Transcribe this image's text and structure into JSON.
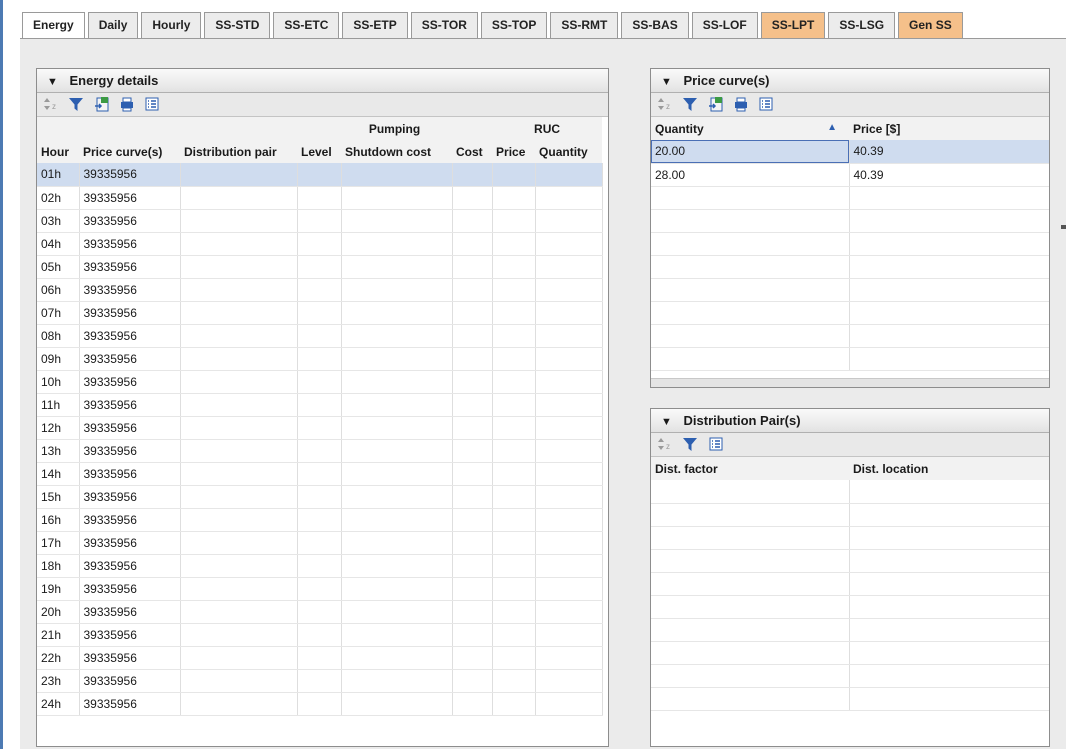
{
  "tabs": [
    {
      "label": "Energy",
      "active": true,
      "orange": false
    },
    {
      "label": "Daily",
      "active": false,
      "orange": false
    },
    {
      "label": "Hourly",
      "active": false,
      "orange": false
    },
    {
      "label": "SS-STD",
      "active": false,
      "orange": false
    },
    {
      "label": "SS-ETC",
      "active": false,
      "orange": false
    },
    {
      "label": "SS-ETP",
      "active": false,
      "orange": false
    },
    {
      "label": "SS-TOR",
      "active": false,
      "orange": false
    },
    {
      "label": "SS-TOP",
      "active": false,
      "orange": false
    },
    {
      "label": "SS-RMT",
      "active": false,
      "orange": false
    },
    {
      "label": "SS-BAS",
      "active": false,
      "orange": false
    },
    {
      "label": "SS-LOF",
      "active": false,
      "orange": false
    },
    {
      "label": "SS-LPT",
      "active": false,
      "orange": true
    },
    {
      "label": "SS-LSG",
      "active": false,
      "orange": false
    },
    {
      "label": "Gen SS",
      "active": false,
      "orange": true
    }
  ],
  "energy": {
    "title": "Energy details",
    "toolbar": [
      "sort-icon",
      "filter-icon",
      "export-excel-icon",
      "print-icon",
      "column-chooser-icon"
    ],
    "group_headers": {
      "pumping": "Pumping",
      "ruc": "RUC"
    },
    "columns": [
      "Hour",
      "Price curve(s)",
      "Distribution pair",
      "Level",
      "Shutdown cost",
      "Cost",
      "Price",
      "Quantity"
    ],
    "rows": [
      {
        "hour": "01h",
        "price_curve": "39335956",
        "selected": true
      },
      {
        "hour": "02h",
        "price_curve": "39335956"
      },
      {
        "hour": "03h",
        "price_curve": "39335956"
      },
      {
        "hour": "04h",
        "price_curve": "39335956"
      },
      {
        "hour": "05h",
        "price_curve": "39335956"
      },
      {
        "hour": "06h",
        "price_curve": "39335956"
      },
      {
        "hour": "07h",
        "price_curve": "39335956"
      },
      {
        "hour": "08h",
        "price_curve": "39335956"
      },
      {
        "hour": "09h",
        "price_curve": "39335956"
      },
      {
        "hour": "10h",
        "price_curve": "39335956"
      },
      {
        "hour": "11h",
        "price_curve": "39335956"
      },
      {
        "hour": "12h",
        "price_curve": "39335956"
      },
      {
        "hour": "13h",
        "price_curve": "39335956"
      },
      {
        "hour": "14h",
        "price_curve": "39335956"
      },
      {
        "hour": "15h",
        "price_curve": "39335956"
      },
      {
        "hour": "16h",
        "price_curve": "39335956"
      },
      {
        "hour": "17h",
        "price_curve": "39335956"
      },
      {
        "hour": "18h",
        "price_curve": "39335956"
      },
      {
        "hour": "19h",
        "price_curve": "39335956"
      },
      {
        "hour": "20h",
        "price_curve": "39335956"
      },
      {
        "hour": "21h",
        "price_curve": "39335956"
      },
      {
        "hour": "22h",
        "price_curve": "39335956"
      },
      {
        "hour": "23h",
        "price_curve": "39335956"
      },
      {
        "hour": "24h",
        "price_curve": "39335956"
      }
    ]
  },
  "price_curves": {
    "title": "Price curve(s)",
    "toolbar": [
      "sort-icon",
      "filter-icon",
      "export-excel-icon",
      "print-icon",
      "column-chooser-icon"
    ],
    "columns": [
      "Quantity",
      "Price [$]"
    ],
    "sort": "ascending",
    "rows": [
      {
        "quantity": "20.00",
        "price": "40.39",
        "selected": true
      },
      {
        "quantity": "28.00",
        "price": "40.39"
      }
    ],
    "empty_rows": 8
  },
  "distribution_pairs": {
    "title": "Distribution Pair(s)",
    "toolbar": [
      "sort-icon",
      "filter-icon",
      "column-chooser-icon"
    ],
    "columns": [
      "Dist. factor",
      "Dist. location"
    ],
    "rows": [],
    "empty_rows": 10
  },
  "colors": {
    "tab_orange": "#f5c08a",
    "selection": "#cfdcef",
    "accent": "#2d5fb0"
  }
}
